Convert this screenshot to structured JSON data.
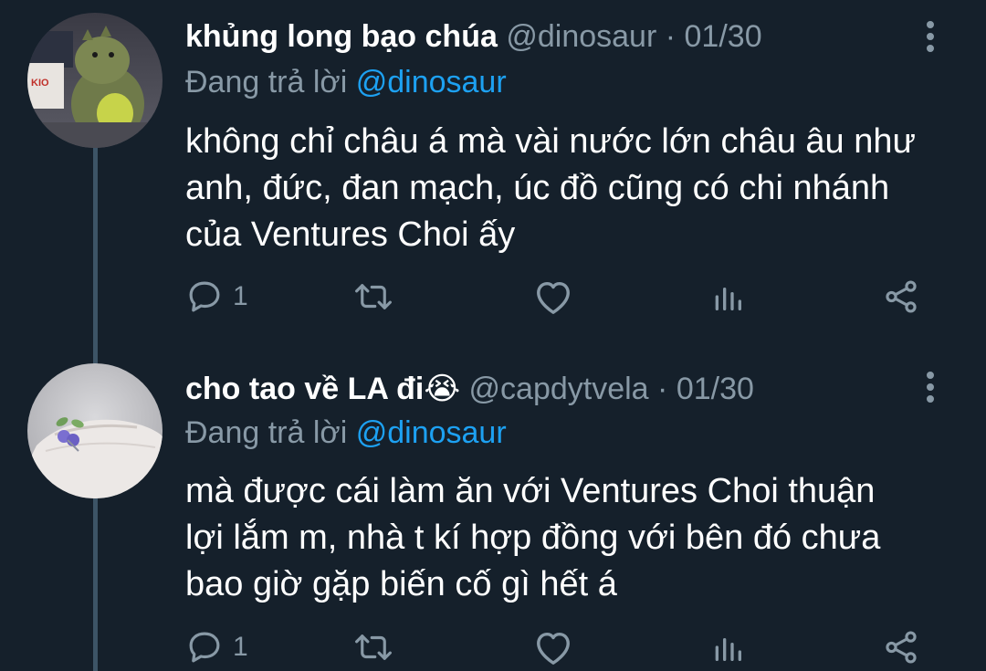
{
  "tweets": [
    {
      "display_name": "khủng long bạo chúa",
      "handle": "@dinosaur",
      "separator": "·",
      "date": "01/30",
      "replying_prefix": "Đang trả lời",
      "replying_to": "@dinosaur",
      "lines": [
        "không chỉ châu á mà vài nước lớn châu âu như",
        "anh, đức, đan mạch, úc đồ cũng có chi nhánh",
        "của Ventures Choi ấy"
      ],
      "reply_count": "1",
      "avatar": "plush-dinosaur-photo"
    },
    {
      "display_name": "cho tao về LA đi",
      "name_emoji": "😭",
      "handle": "@capdytvela",
      "separator": "·",
      "date": "01/30",
      "replying_prefix": "Đang trả lời",
      "replying_to": "@dinosaur",
      "lines": [
        "mà được cái làm ăn với Ventures Choi thuận",
        "lợi lắm m, nhà t kí hợp đồng với bên đó chưa",
        "bao giờ gặp biến cố gì hết á"
      ],
      "reply_count": "1",
      "avatar": "hand-with-blueberry-ring-photo"
    }
  ],
  "colors": {
    "background": "#15202b",
    "text_primary": "#ffffff",
    "text_secondary": "#8899a6",
    "link": "#1da1f2",
    "thread_line": "#3d5466"
  }
}
